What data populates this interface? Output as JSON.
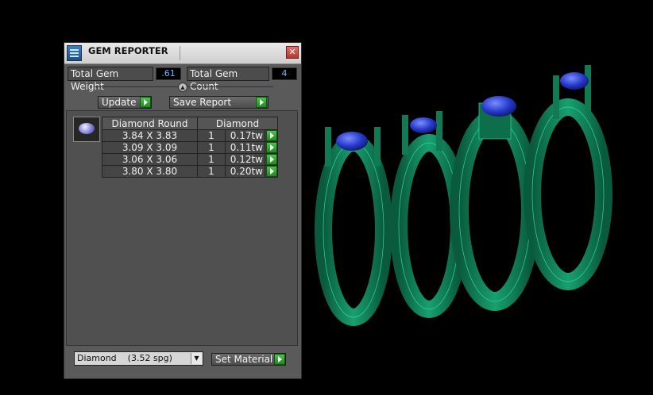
{
  "window": {
    "title": "GEM REPORTER"
  },
  "summary": {
    "total_weight_label": "Total Gem Weight",
    "total_weight_value": ".61",
    "total_count_label": "Total Gem Count",
    "total_count_value": "4"
  },
  "toolbar": {
    "update_label": "Update",
    "save_report_label": "Save Report"
  },
  "table": {
    "headers": [
      "Diamond Round",
      "Diamond"
    ],
    "rows": [
      {
        "size": "3.84 X 3.83",
        "count": "1",
        "weight": "0.17tw"
      },
      {
        "size": "3.09 X 3.09",
        "count": "1",
        "weight": "0.11tw"
      },
      {
        "size": "3.06 X 3.06",
        "count": "1",
        "weight": "0.12tw"
      },
      {
        "size": "3.80 X 3.80",
        "count": "1",
        "weight": "0.20tw"
      }
    ]
  },
  "material": {
    "selected": "Diamond    (3.52 spg)",
    "set_label": "Set Material"
  },
  "colors": {
    "ring": "#0f7a55",
    "gem": "#2438c8",
    "panel": "#5a5a5a"
  },
  "icons": [
    "app-icon",
    "close-icon",
    "gem-thumbnail-icon",
    "play-arrow-icon",
    "dropdown-arrow-icon"
  ]
}
